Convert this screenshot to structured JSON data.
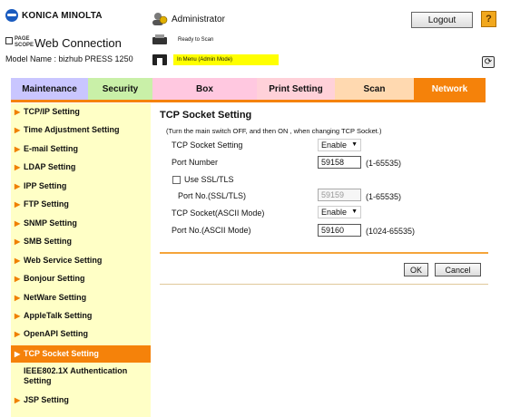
{
  "header": {
    "brand": "KONICA MINOLTA",
    "product_logo_line1": "PAGE",
    "product_logo_line2": "SCOPE",
    "product": "Web Connection",
    "model": "Model Name : bizhub PRESS 1250",
    "user": "Administrator",
    "logout_label": "Logout",
    "help_label": "?",
    "status_ready": "Ready to Scan",
    "status_mode": "In Menu (Admin Mode)",
    "refresh_icon": "refresh-icon"
  },
  "tabs": [
    {
      "label": "Maintenance",
      "color": "#c9c6ff"
    },
    {
      "label": "Security",
      "color": "#c9f0a8"
    },
    {
      "label": "Box",
      "color": "#ffc8e0"
    },
    {
      "label": "Print Setting",
      "color": "#ffd1d9"
    },
    {
      "label": "Scan",
      "color": "#ffd9b0"
    },
    {
      "label": "Network",
      "color": "#f5820a",
      "active": true
    }
  ],
  "sidebar": {
    "items": [
      {
        "label": "TCP/IP Setting"
      },
      {
        "label": "Time Adjustment Setting"
      },
      {
        "label": "E-mail Setting"
      },
      {
        "label": "LDAP Setting"
      },
      {
        "label": "IPP Setting"
      },
      {
        "label": "FTP Setting"
      },
      {
        "label": "SNMP Setting"
      },
      {
        "label": "SMB Setting"
      },
      {
        "label": "Web Service Setting"
      },
      {
        "label": "Bonjour Setting"
      },
      {
        "label": "NetWare Setting"
      },
      {
        "label": "AppleTalk Setting"
      },
      {
        "label": "OpenAPI Setting"
      },
      {
        "label": "TCP Socket Setting",
        "active": true
      },
      {
        "label": "IEEE802.1X Authentication Setting"
      },
      {
        "label": "JSP Setting"
      }
    ]
  },
  "main": {
    "title": "TCP Socket Setting",
    "notice": "(Turn the main switch OFF, and then ON , when changing TCP Socket.)",
    "tcp_socket_label": "TCP Socket Setting",
    "tcp_socket_value": "Enable",
    "port_label": "Port Number",
    "port_value": "59158",
    "port_range": "(1-65535)",
    "ssl_label": "Use SSL/TLS",
    "ssl_checked": false,
    "ssl_port_label": "Port No.(SSL/TLS)",
    "ssl_port_value": "59159",
    "ssl_port_range": "(1-65535)",
    "ascii_label": "TCP Socket(ASCII Mode)",
    "ascii_value": "Enable",
    "ascii_port_label": "Port No.(ASCII Mode)",
    "ascii_port_value": "59160",
    "ascii_port_range": "(1024-65535)",
    "ok_label": "OK",
    "cancel_label": "Cancel"
  },
  "colors": {
    "accent": "#f5820a",
    "sidebar_bg": "#ffffc6",
    "status_highlight": "#ffff00"
  }
}
